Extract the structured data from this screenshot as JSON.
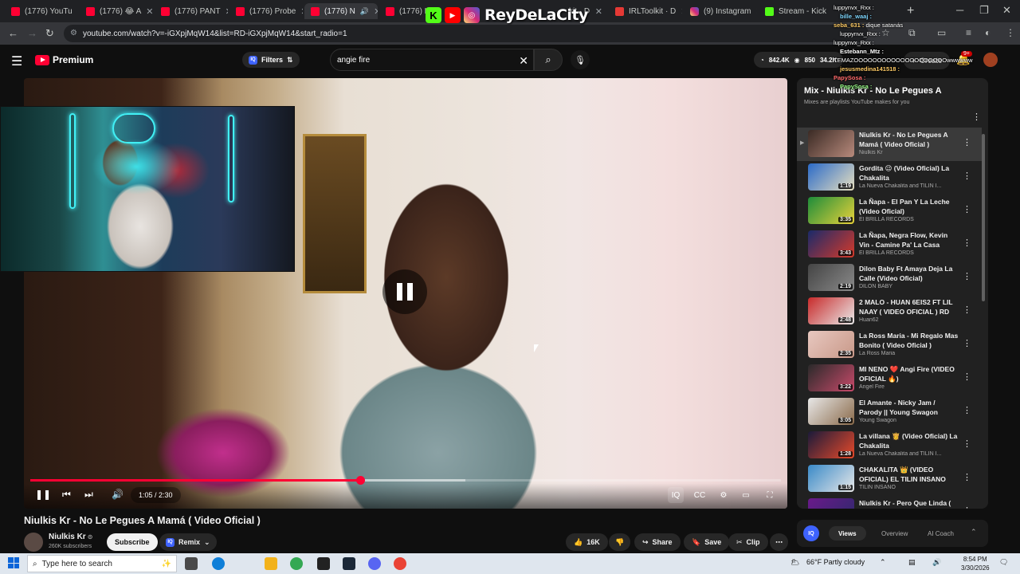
{
  "browser": {
    "tabs": [
      {
        "label": "(1776) YouTu",
        "icon": "youtube-icon"
      },
      {
        "label": "(1776) 😂 A",
        "icon": "youtube-icon"
      },
      {
        "label": "(1776) PANT",
        "icon": "youtube-icon"
      },
      {
        "label": "(1776) Probe",
        "icon": "youtube-icon"
      },
      {
        "label": "(1776) N",
        "icon": "youtube-icon",
        "active": true
      },
      {
        "label": "(1776) Lil",
        "icon": "youtube-icon"
      },
      {
        "label": "kit · D",
        "icon": "kick-icon"
      },
      {
        "label": "IRLToolkit · D",
        "icon": "irltoolkit-icon"
      },
      {
        "label": "(9) Instagram",
        "icon": "instagram-icon"
      },
      {
        "label": "Stream - Kick",
        "icon": "kick-icon"
      }
    ],
    "url": "youtube.com/watch?v=-iGXpjMqW14&list=RD-iGXpjMqW14&start_radio=1"
  },
  "overlay": {
    "brand_name": "ReyDeLaCity",
    "chat": [
      {
        "user": "",
        "text": "luppynvx_Rxx :"
      },
      {
        "user": "bille_waaj :",
        "text": ""
      },
      {
        "user": "seba_631 :",
        "text": "dique satanás"
      },
      {
        "user": "",
        "text": "luppynvx_Rxx :"
      },
      {
        "user": "",
        "text": "luppynvx_Rxx :"
      },
      {
        "user": "Estebann_Mtz :",
        "text": ""
      },
      {
        "user": "",
        "text": "TEMAZOOOOOOOOOOOOOOOOOOOOwwwwww"
      },
      {
        "user": "jesusmedina141518 :",
        "text": ""
      },
      {
        "user": "PapySosa :",
        "text": ""
      },
      {
        "user": "PapySosa :",
        "text": ""
      }
    ]
  },
  "youtube": {
    "logo_text": "Premium",
    "filters_label": "Filters",
    "search_query": "angie fire",
    "stats": {
      "views": "842.4K",
      "likes": "850",
      "other": "34.2K"
    },
    "create_label": "Create",
    "notifications_badge": "9+"
  },
  "player": {
    "current_time": "1:05",
    "duration": "2:30",
    "time_display": "1:05 / 2:30",
    "progress_fraction": 0.44,
    "buffer_fraction": 0.58
  },
  "video": {
    "title": "Niulkis Kr - No Le Pegues A Mamá ( Video Oficial )",
    "channel": "Niulkis Kr",
    "subscribers": "260K subscribers",
    "subscribe_label": "Subscribe",
    "remix_label": "Remix",
    "likes": "16K",
    "share_label": "Share",
    "save_label": "Save",
    "clip_label": "Clip"
  },
  "mix": {
    "title": "Mix - Niulkis Kr - No Le Pegues A",
    "subtitle": "Mixes are playlists YouTube makes for you",
    "items": [
      {
        "title": "Niulkis Kr - No Le Pegues A Mamá ( Video Oficial )",
        "channel": "Niulkis Kr",
        "duration": "",
        "current": true,
        "colors": [
          "#3a2a24",
          "#b88a7c"
        ]
      },
      {
        "title": "Gordita 😉 (Video Oficial) La Chakalita",
        "channel": "La Nueva Chakalita and TILIN I...",
        "duration": "1:19",
        "colors": [
          "#2a6ac8",
          "#e8e0c0"
        ]
      },
      {
        "title": "La Ñapa - El Pan Y La Leche (Video Oficial)",
        "channel": "El BRILLA RECORDS",
        "duration": "3:35",
        "colors": [
          "#1d8c3a",
          "#e8d23a"
        ]
      },
      {
        "title": "La Ñapa, Negra Flow, Kevin Vin - Camine Pa' La Casa (Video...",
        "channel": "El BRILLA RECORDS",
        "duration": "3:43",
        "colors": [
          "#1a2a6a",
          "#d63a2a"
        ]
      },
      {
        "title": "Dilon Baby Ft Amaya Deja La Calle (Video Oficial)",
        "channel": "DILON BABY",
        "duration": "2:19",
        "colors": [
          "#444444",
          "#8a8a8a"
        ]
      },
      {
        "title": "2 MALO - HUAN 6EIS2 FT LIL NAAY ( VIDEO OFICIAL ) RD",
        "channel": "Huan62",
        "duration": "2:48",
        "colors": [
          "#c82a2a",
          "#eaeaea"
        ]
      },
      {
        "title": "La Ross Maria - Mi Regalo Mas Bonito ( Video Oficial )",
        "channel": "La Ross Maria",
        "duration": "2:35",
        "colors": [
          "#e8c8c0",
          "#c89888"
        ]
      },
      {
        "title": "MI NENO ❤️ Angi Fire (VIDEO OFICIAL 🔥)",
        "channel": "Angel Fire",
        "duration": "3:22",
        "colors": [
          "#2a2a2a",
          "#c84a6a"
        ]
      },
      {
        "title": "El Amante - Nicky Jam / Parody || Young Swagon",
        "channel": "Young Swagon",
        "duration": "3:05",
        "colors": [
          "#e8e8e8",
          "#8a6a4a"
        ]
      },
      {
        "title": "La villana 👸 (Video Oficial) La Chakalita",
        "channel": "La Nueva Chakalita and TILIN I...",
        "duration": "1:28",
        "colors": [
          "#1a1a3a",
          "#e84a2a"
        ]
      },
      {
        "title": "CHAKALITA 👑 (VIDEO OFICIAL) EL TILIN INSANO",
        "channel": "TILIN INSANO",
        "duration": "1:15",
        "colors": [
          "#3a8ac8",
          "#e8e8e8"
        ]
      },
      {
        "title": "Niulkis Kr - Pero Que Linda (",
        "channel": "",
        "duration": "",
        "colors": [
          "#6a1a8a",
          "#2a2a6a"
        ]
      }
    ]
  },
  "analytics": {
    "logo": "IQ",
    "tabs": [
      "Views",
      "Overview",
      "AI Coach"
    ],
    "active_tab": "Views"
  },
  "taskbar": {
    "search_placeholder": "Type here to search",
    "weather": "66°F  Partly cloudy",
    "time": "8:54 PM",
    "date": "3/30/2026"
  }
}
